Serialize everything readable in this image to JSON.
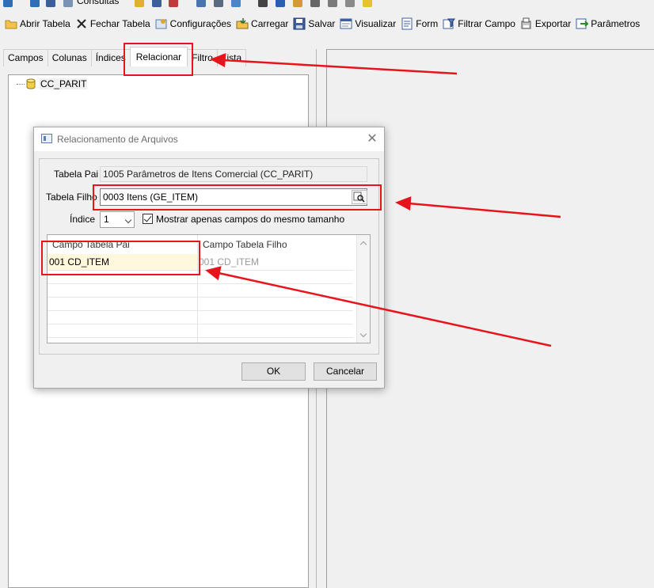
{
  "top_strip": {
    "consultas_label": "Consultas"
  },
  "toolbar": {
    "buttons": [
      {
        "label": "Abrir Tabela",
        "icon": "folder-open-icon"
      },
      {
        "label": "Fechar Tabela",
        "icon": "close-x-icon"
      },
      {
        "label": "Configurações",
        "icon": "settings-icon"
      },
      {
        "label": "Carregar",
        "icon": "load-icon"
      },
      {
        "label": "Salvar",
        "icon": "save-icon"
      },
      {
        "label": "Visualizar",
        "icon": "view-icon"
      },
      {
        "label": "Form",
        "icon": "form-icon"
      },
      {
        "label": "Filtrar Campo",
        "icon": "filter-icon"
      },
      {
        "label": "Exportar",
        "icon": "export-icon"
      },
      {
        "label": "Parâmetros",
        "icon": "parameters-icon"
      }
    ]
  },
  "tabs": [
    {
      "label": "Campos",
      "active": false
    },
    {
      "label": "Colunas",
      "active": false
    },
    {
      "label": "Índices",
      "active": false
    },
    {
      "label": "Relacionar",
      "active": true
    },
    {
      "label": "Filtro",
      "active": false
    },
    {
      "label": "Lista",
      "active": false
    }
  ],
  "tree": {
    "items": [
      {
        "label": "CC_PARIT",
        "icon": "database-icon"
      }
    ]
  },
  "dialog": {
    "title": "Relacionamento de Arquivos",
    "tabela_pai_label": "Tabela Pai",
    "tabela_pai_value": "1005 Parâmetros de Itens Comercial (CC_PARIT)",
    "tabela_filho_label": "Tabela Filho",
    "tabela_filho_value": "0003 Itens (GE_ITEM)",
    "indice_label": "Índice",
    "indice_value": "1",
    "checkbox_label": "Mostrar apenas campos do mesmo tamanho",
    "checkbox_checked": true,
    "grid": {
      "headers": [
        "Campo Tabela Pai",
        "Campo Tabela Filho"
      ],
      "rows": [
        {
          "pai": "001  CD_ITEM",
          "filho": "001  CD_ITEM"
        }
      ]
    },
    "ok_label": "OK",
    "cancel_label": "Cancelar"
  },
  "colors": {
    "annotation_red": "#e8141b",
    "selected_row": "#fff8dc"
  }
}
